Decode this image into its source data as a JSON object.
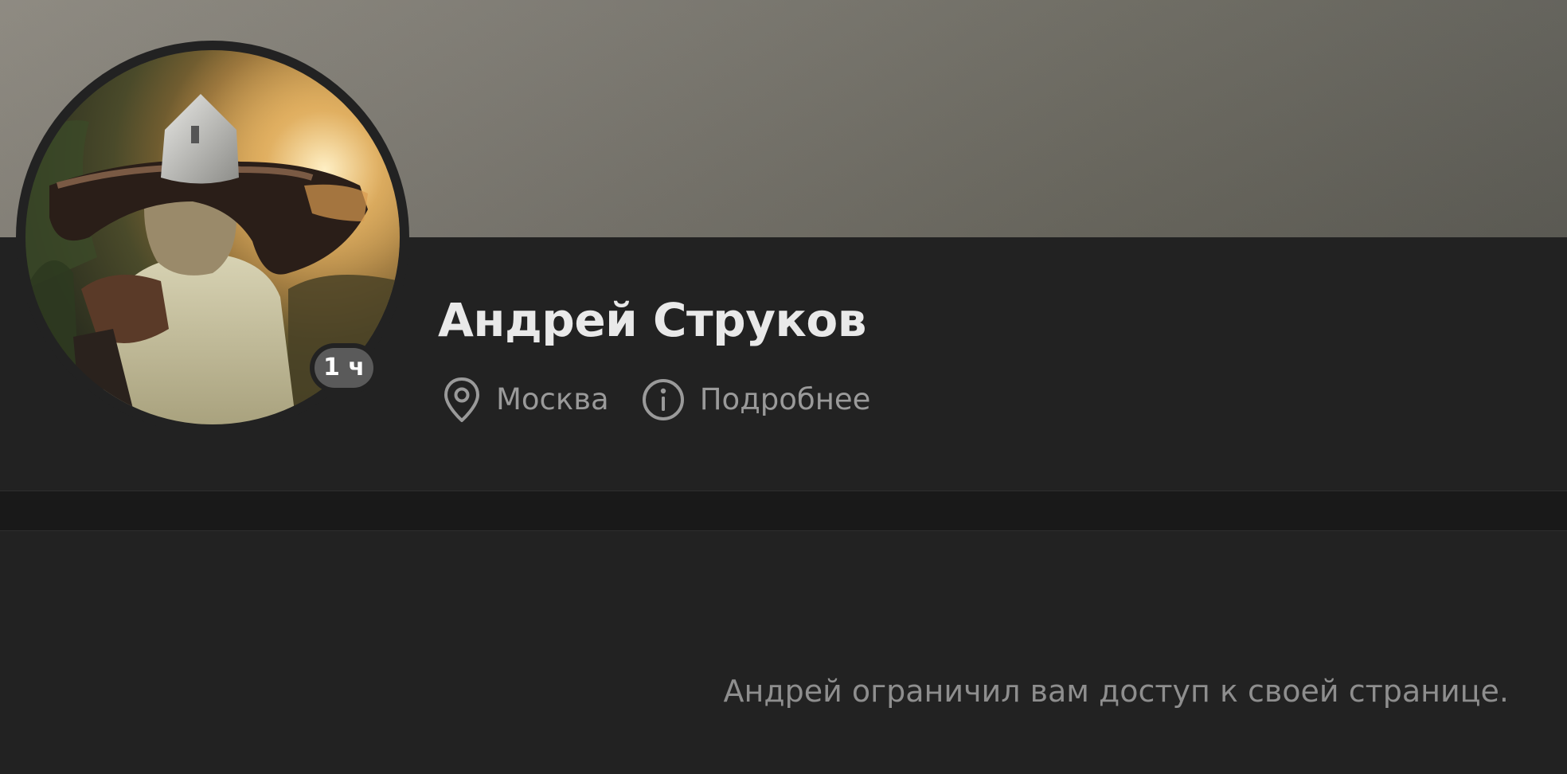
{
  "profile": {
    "name": "Андрей Струков",
    "status_badge": "1 ч",
    "location": "Москва",
    "details_link": "Подробнее",
    "restricted_message": "Андрей ограничил вам доступ к своей странице."
  },
  "icons": {
    "location": "map-pin-icon",
    "details": "info-icon"
  },
  "colors": {
    "background": "#222222",
    "separator": "#191919",
    "name_text": "#e9e9e9",
    "secondary_text": "#9a9a9a",
    "badge": "#5a5a5a"
  }
}
